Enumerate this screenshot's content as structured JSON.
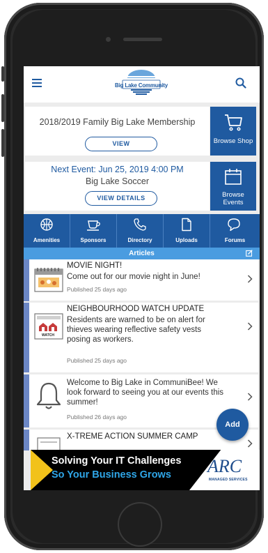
{
  "header": {
    "logo_text": "Big Lake Community",
    "menu_icon": "hamburger-icon",
    "search_icon": "search-icon"
  },
  "membership": {
    "title": "2018/2019 Family Big Lake Membership",
    "button": "VIEW",
    "tile_label": "Browse Shop",
    "tile_icon": "cart-icon"
  },
  "event": {
    "title": "Next Event: Jun 25, 2019 4:00 PM",
    "subtitle": "Big Lake Soccer",
    "button": "VIEW DETAILS",
    "tile_label_1": "Browse",
    "tile_label_2": "Events",
    "tile_icon": "calendar-icon"
  },
  "nav": [
    {
      "label": "Amenities",
      "icon": "basketball-icon"
    },
    {
      "label": "Sponsors",
      "icon": "coffee-cup-icon"
    },
    {
      "label": "Directory",
      "icon": "phone-icon"
    },
    {
      "label": "Uploads",
      "icon": "document-icon"
    },
    {
      "label": "Forums",
      "icon": "chat-bubble-icon"
    }
  ],
  "articles": {
    "header": "Articles",
    "items": [
      {
        "title": "MOVIE NIGHT!",
        "body": "Come out for our movie night in June!",
        "meta": "Published 25 days ago"
      },
      {
        "title": "NEIGHBOURHOOD WATCH UPDATE",
        "body_lines": [
          "Residents are warned to be on alert for",
          "thieves wearing reflective safety vests",
          "posing as workers."
        ],
        "meta": "Published 25 days ago",
        "thumb_label": "WATCH"
      },
      {
        "body_lines": [
          "Welcome to Big Lake in CommuniBee! We",
          "look forward to seeing you at our events this",
          "summer!"
        ],
        "meta": "Published 26 days ago"
      },
      {
        "title": "X-TREME ACTION SUMMER CAMP"
      }
    ]
  },
  "fab": {
    "label": "Add"
  },
  "ad": {
    "line1": "Solving Your IT Challenges",
    "line2": "So Your Business Grows",
    "logo": "ARC",
    "logo_sub": "MANAGED SERVICES"
  },
  "colors": {
    "primary": "#1f5aa0",
    "articles_bar": "#4a9ce0",
    "ad_accent": "#f2c21a",
    "ad_blue": "#2fa6e8"
  }
}
